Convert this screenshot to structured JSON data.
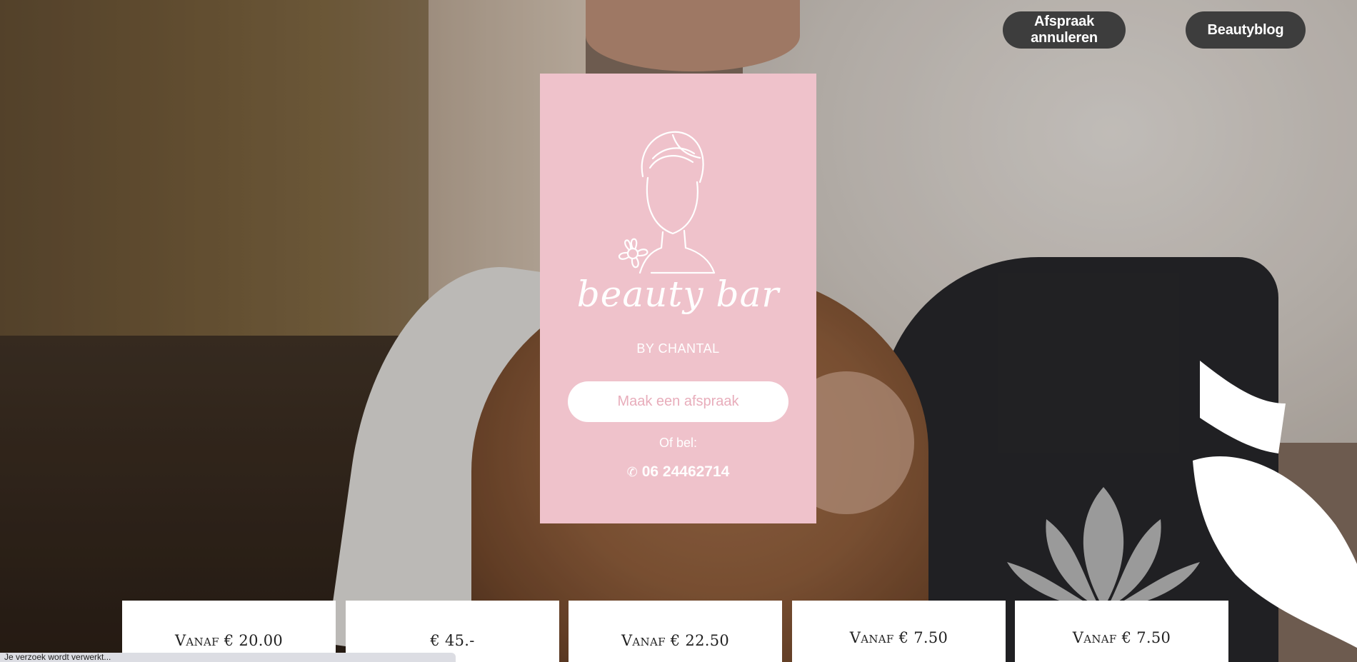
{
  "header": {
    "cancel_label": "Afspraak annuleren",
    "blog_label": "Beautyblog"
  },
  "card": {
    "brand_script": "beauty bar",
    "brand_sub": "BY CHANTAL",
    "cta_label": "Maak een afspraak",
    "or_call": "Of bel:",
    "phone_icon": "✆",
    "phone": "06 24462714",
    "background_color": "#efc2cb"
  },
  "prices": [
    {
      "label": "Vanaf € 20.00"
    },
    {
      "label": "€ 45.-"
    },
    {
      "label": "Vanaf € 22.50"
    },
    {
      "label": "Vanaf € 7.50"
    },
    {
      "label": "Vanaf € 7.50"
    }
  ],
  "status": {
    "text": "Je verzoek wordt verwerkt..."
  },
  "colors": {
    "nav_button": "#3d3d3d",
    "cta_text": "#e8adbb"
  }
}
